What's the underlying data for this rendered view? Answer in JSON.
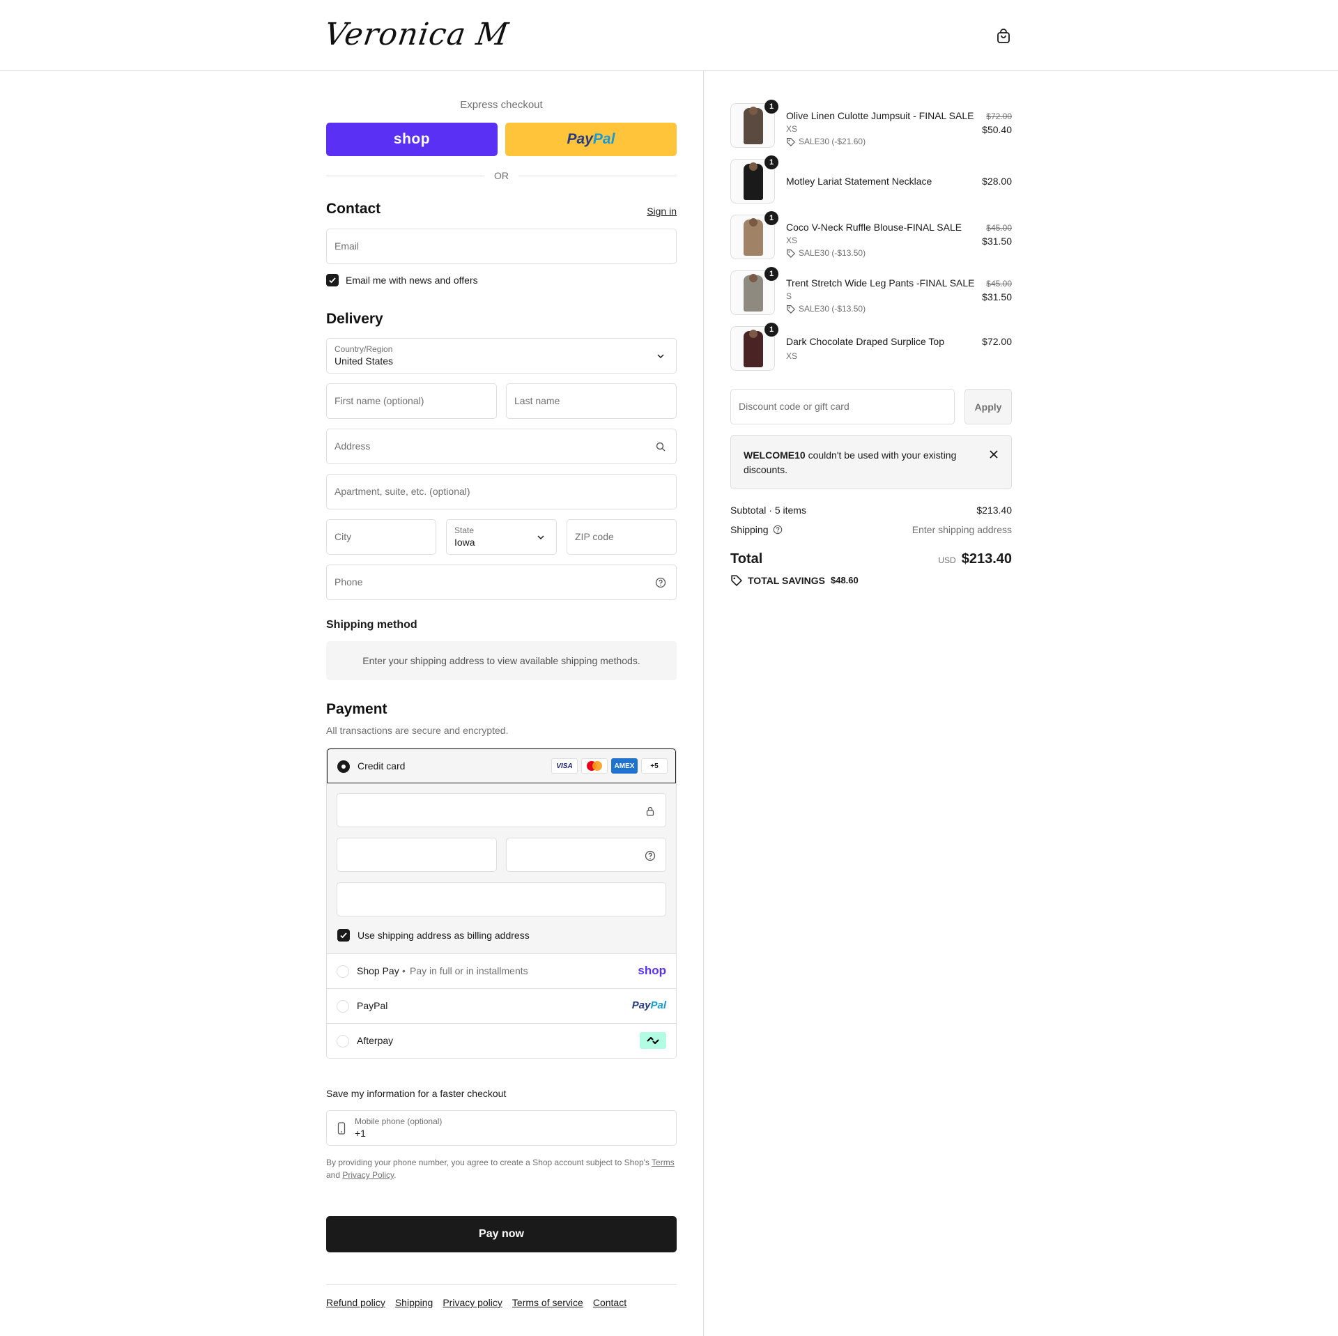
{
  "header": {
    "brand": "Veronica M"
  },
  "express": {
    "label": "Express checkout",
    "shop_label": "shop",
    "paypal_part1": "Pay",
    "paypal_part2": "Pal",
    "or_label": "OR"
  },
  "contact": {
    "title": "Contact",
    "sign_in": "Sign in",
    "email_placeholder": "Email",
    "news_label": "Email me with news and offers",
    "news_checked": true
  },
  "delivery": {
    "title": "Delivery",
    "country_label": "Country/Region",
    "country_value": "United States",
    "first_name_placeholder": "First name (optional)",
    "last_name_placeholder": "Last name",
    "address_placeholder": "Address",
    "apartment_placeholder": "Apartment, suite, etc. (optional)",
    "city_placeholder": "City",
    "state_label": "State",
    "state_value": "Iowa",
    "zip_placeholder": "ZIP code",
    "phone_placeholder": "Phone"
  },
  "shipping_method": {
    "title": "Shipping method",
    "message": "Enter your shipping address to view available shipping methods."
  },
  "payment": {
    "title": "Payment",
    "subtitle": "All transactions are secure and encrypted.",
    "credit_card_label": "Credit card",
    "card_brands": [
      "VISA",
      "",
      "AMEX",
      "+5"
    ],
    "billing_same_label": "Use shipping address as billing address",
    "shop_pay_label": "Shop Pay",
    "shop_pay_sub": "Pay in full or in installments",
    "shop_pay_logo": "shop",
    "paypal_label": "PayPal",
    "paypal_logo_1": "Pay",
    "paypal_logo_2": "Pal",
    "afterpay_label": "Afterpay"
  },
  "save_info": {
    "title": "Save my information for a faster checkout",
    "mobile_label": "Mobile phone (optional)",
    "mobile_value": "+1",
    "disclaimer_1": "By providing your phone number, you agree to create a Shop account subject to Shop's ",
    "terms": "Terms",
    "disclaimer_and": "and ",
    "privacy": "Privacy Policy",
    "disclaimer_end": "."
  },
  "pay_now": "Pay now",
  "footer_links": [
    "Refund policy",
    "Shipping",
    "Privacy policy",
    "Terms of service",
    "Contact"
  ],
  "cart": {
    "items": [
      {
        "qty": "1",
        "name": "Olive Linen Culotte Jumpsuit - FINAL SALE",
        "variant": "XS",
        "discount": "SALE30 (-$21.60)",
        "original": "$72.00",
        "price": "$50.40",
        "color": "#5b4a3f"
      },
      {
        "qty": "1",
        "name": "Motley Lariat Statement Necklace",
        "variant": "",
        "discount": "",
        "original": "",
        "price": "$28.00",
        "color": "#1a1a1a"
      },
      {
        "qty": "1",
        "name": "Coco V-Neck Ruffle Blouse-FINAL SALE",
        "variant": "XS",
        "discount": "SALE30 (-$13.50)",
        "original": "$45.00",
        "price": "$31.50",
        "color": "#a08266"
      },
      {
        "qty": "1",
        "name": "Trent Stretch Wide Leg Pants -FINAL SALE",
        "variant": "S",
        "discount": "SALE30 (-$13.50)",
        "original": "$45.00",
        "price": "$31.50",
        "color": "#8f8a80"
      },
      {
        "qty": "1",
        "name": "Dark Chocolate Draped Surplice Top",
        "variant": "XS",
        "discount": "",
        "original": "",
        "price": "$72.00",
        "color": "#4a2424"
      }
    ],
    "discount_placeholder": "Discount code or gift card",
    "apply_label": "Apply",
    "notice_code": "WELCOME10",
    "notice_text": " couldn't be used with your existing",
    "notice_text2": "discounts.",
    "subtotal_label": "Subtotal · 5 items",
    "subtotal_value": "$213.40",
    "shipping_label": "Shipping",
    "shipping_value": "Enter shipping address",
    "total_label": "Total",
    "currency": "USD",
    "total_value": "$213.40",
    "savings_label": "TOTAL SAVINGS",
    "savings_value": "$48.60"
  }
}
